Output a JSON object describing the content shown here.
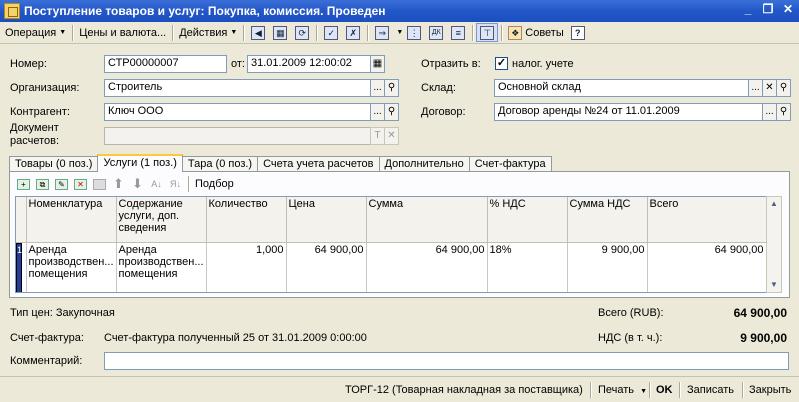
{
  "window": {
    "title": "Поступление товаров и услуг: Покупка, комиссия. Проведен",
    "minimize": "_",
    "restore": "❐",
    "close": "✕"
  },
  "toolbar": {
    "operation": "Операция",
    "prices_currency": "Цены и валюта...",
    "actions": "Действия",
    "tips": "Советы",
    "help": "?"
  },
  "header": {
    "number_label": "Номер:",
    "number_value": "СТР00000007",
    "from_label": "от:",
    "date_value": "31.01.2009 12:00:02",
    "org_label": "Организация:",
    "org_value": "Строитель",
    "counterparty_label": "Контрагент:",
    "counterparty_value": "Ключ ООО",
    "settlement_doc_label_1": "Документ",
    "settlement_doc_label_2": "расчетов:",
    "settlement_doc_value": "",
    "reflect_label": "Отразить в:",
    "tax_accounting_label": "налог. учете",
    "tax_accounting_checked": true,
    "warehouse_label": "Склад:",
    "warehouse_value": "Основной склад",
    "contract_label": "Договор:",
    "contract_value": "Договор аренды №24 от 11.01.2009"
  },
  "tabs": [
    {
      "label": "Товары (0 поз.)",
      "active": false
    },
    {
      "label": "Услуги (1 поз.)",
      "active": true
    },
    {
      "label": "Тара (0 поз.)",
      "active": false
    },
    {
      "label": "Счета учета расчетов",
      "active": false
    },
    {
      "label": "Дополнительно",
      "active": false
    },
    {
      "label": "Счет-фактура",
      "active": false
    }
  ],
  "services": {
    "selection_label": "Подбор",
    "columns": [
      "Номенклатура",
      "Содержание услуги, доп. сведения",
      "Количество",
      "Цена",
      "Сумма",
      "% НДС",
      "Сумма НДС",
      "Всего"
    ],
    "rows": [
      {
        "number": "1",
        "nomenclature": "Аренда производствен... помещения",
        "content": "Аренда производствен... помещения",
        "quantity": "1,000",
        "price": "64 900,00",
        "sum": "64 900,00",
        "vat_rate": "18%",
        "vat_sum": "9 900,00",
        "total": "64 900,00"
      }
    ]
  },
  "footer": {
    "price_type": "Тип цен: Закупочная",
    "total_label": "Всего (RUB):",
    "total_value": "64 900,00",
    "invoice_label": "Счет-фактура:",
    "invoice_value": "Счет-фактура полученный 25 от 31.01.2009 0:00:00",
    "vat_label": "НДС (в т. ч.):",
    "vat_value": "9 900,00",
    "comment_label": "Комментарий:",
    "comment_value": ""
  },
  "statusbar": {
    "torg": "ТОРГ-12 (Товарная накладная за поставщика)",
    "print": "Печать",
    "ok": "OK",
    "save": "Записать",
    "close": "Закрыть"
  }
}
